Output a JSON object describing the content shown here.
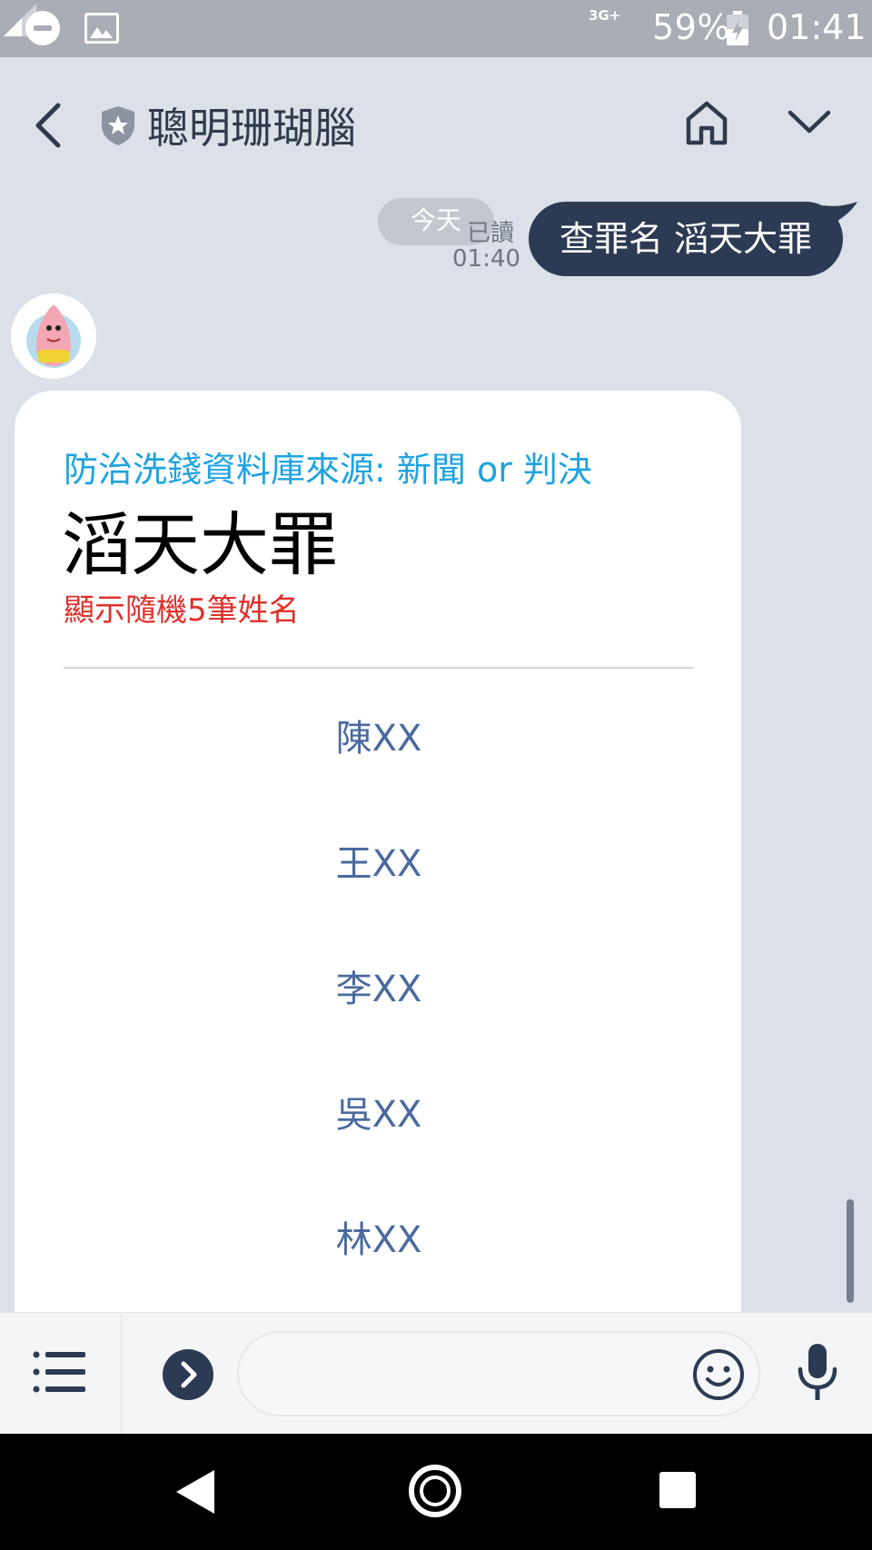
{
  "status_bar": {
    "network": "3G+",
    "battery": "59%",
    "time": "01:41"
  },
  "header": {
    "title": "聰明珊瑚腦"
  },
  "sent_message": {
    "date_pill": "今天",
    "read_label": "已讀",
    "time": "01:40",
    "text": "查罪名 滔天大罪"
  },
  "card": {
    "source": "防治洗錢資料庫來源: 新聞 or 判決",
    "title": "滔天大罪",
    "subtitle": "顯示隨機5筆姓名",
    "names": [
      "陳XX",
      "王XX",
      "李XX",
      "吳XX",
      "林XX"
    ]
  },
  "colors": {
    "background": "#dbe0e9",
    "bubble": "#2c3a53",
    "source_text": "#1ea3e0",
    "subtitle_text": "#e0302b",
    "name_text": "#4a6a9f"
  },
  "icons": [
    "dnd-icon",
    "image-icon",
    "signal-icon",
    "battery-icon",
    "back-icon",
    "shield-icon",
    "home-icon",
    "chevron-down-icon",
    "menu-icon",
    "expand-icon",
    "emoji-icon",
    "mic-icon",
    "nav-back-icon",
    "nav-home-icon",
    "nav-recents-icon"
  ]
}
